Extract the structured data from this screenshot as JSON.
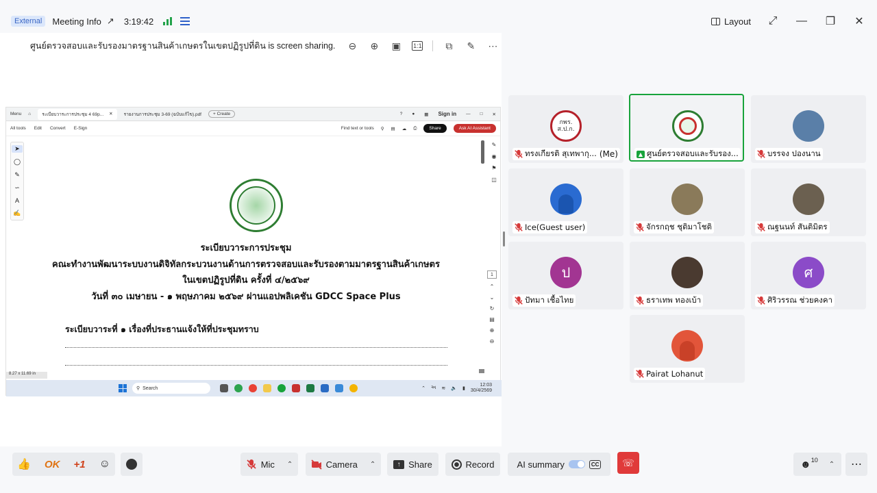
{
  "titlebar": {
    "badge": "External",
    "title": "Meeting Info",
    "timer": "3:19:42",
    "layout_label": "Layout"
  },
  "share": {
    "sharing_text": "ศูนย์ตรวจสอบและรับรองมาตรฐานสินค้าเกษตรในเขตปฏิรูปที่ดิน is screen sharing."
  },
  "pdf": {
    "menu_label": "Menu",
    "tab1": "ระเบียบวาระการประชุม 4 69p...",
    "tab2": "รายงานการประชุม 3-69 (ฉบับแก้ไข).pdf",
    "create_label": "+ Create",
    "signin": "Sign in",
    "menu_items": [
      "All tools",
      "Edit",
      "Convert",
      "E-Sign"
    ],
    "find_label": "Find text or tools",
    "share_btn": "Share",
    "ai_btn": "Ask AI Assistant",
    "page_num": "1",
    "page_size": "8.27 x 11.69 in",
    "doc": {
      "heading": "ระเบียบวาระการประชุม",
      "line2": "คณะทำงานพัฒนาระบบงานดิจิทัลกระบวนงานด้านการตรวจสอบและรับรองตามมาตรฐานสินค้าเกษตร",
      "line3": "ในเขตปฏิรูปที่ดิน ครั้งที่ ๔/๒๕๖๙",
      "line4": "วันที่ ๓๐ เมษายน - ๑ พฤษภาคม ๒๕๖๙ ผ่านแอปพลิเคชัน GDCC Space Plus",
      "agenda": "ระเบียบวาระที่ ๑   เรื่องที่ประธานแจ้งให้ที่ประชุมทราบ"
    },
    "taskbar": {
      "search": "Search",
      "time": "12:03",
      "date": "30/4/2569"
    }
  },
  "participants": [
    {
      "name": "ทรงเกียรติ สุเทพากุ...",
      "suffix": "(Me)",
      "avatar_text": "กพร. ส.ป.ก.",
      "avatar_color": "#ffffff"
    },
    {
      "name": "ศูนย์ตรวจสอบและรับรอง...",
      "suffix": "",
      "avatar_text": "",
      "avatar_color": "#ffffff"
    },
    {
      "name": "บรรจง ปองนาน",
      "suffix": "",
      "avatar_text": "",
      "avatar_color": "#5a7fa8"
    },
    {
      "name": "Ice(Guest user)",
      "suffix": "",
      "avatar_text": "",
      "avatar_color": "#2a6bd1"
    },
    {
      "name": "จักรกฤช ชุติมาโชติ",
      "suffix": "",
      "avatar_text": "",
      "avatar_color": "#8a7a5a"
    },
    {
      "name": "ณฐนนท์ สันติมิตร",
      "suffix": "",
      "avatar_text": "",
      "avatar_color": "#6b6050"
    },
    {
      "name": "ปัทมา เชื้อไทย",
      "suffix": "",
      "avatar_text": "ป",
      "avatar_color": "#a23592"
    },
    {
      "name": "ธราเทพ ทองเบ้า",
      "suffix": "",
      "avatar_text": "",
      "avatar_color": "#4a3a30"
    },
    {
      "name": "ศิริวรรณ ช่วยคงคา",
      "suffix": "",
      "avatar_text": "ศ",
      "avatar_color": "#8b4bc8"
    },
    {
      "name": "Pairat Lohanut",
      "suffix": "",
      "avatar_text": "",
      "avatar_color": "#e2553a"
    }
  ],
  "toolbar": {
    "react_ok": "OK",
    "react_plus": "+1",
    "mic": "Mic",
    "camera": "Camera",
    "share": "Share",
    "record": "Record",
    "ai_summary": "AI summary",
    "cc": "CC",
    "participants_count": "10"
  },
  "colors": {
    "accent_green": "#18a33b",
    "mute_red": "#d63a3a",
    "hangup_red": "#e03a3a",
    "external_blue": "#3a66c4"
  }
}
